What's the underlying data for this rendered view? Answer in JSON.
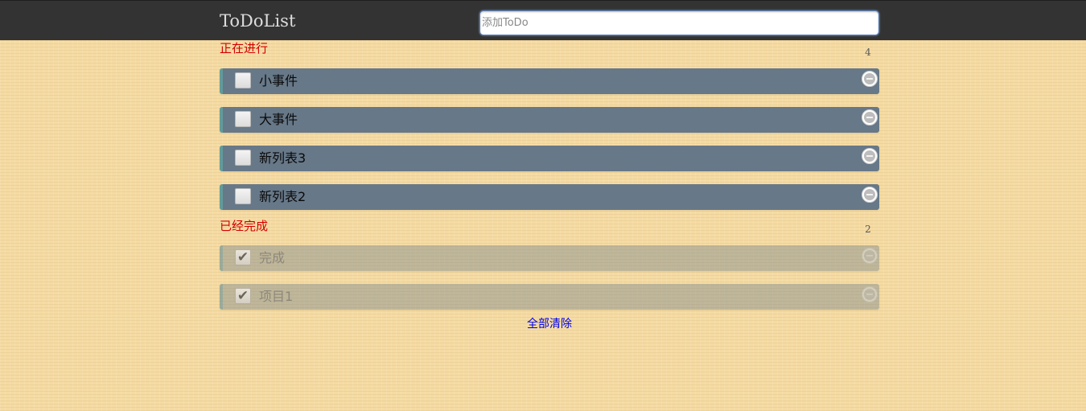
{
  "header": {
    "title": "ToDoList",
    "input_placeholder": "添加ToDo",
    "input_value": ""
  },
  "doing": {
    "title": "正在进行",
    "count": "4",
    "items": [
      {
        "text": "小事件",
        "checked": false
      },
      {
        "text": "大事件",
        "checked": false
      },
      {
        "text": "新列表3",
        "checked": false
      },
      {
        "text": "新列表2",
        "checked": false
      }
    ]
  },
  "done": {
    "title": "已经完成",
    "count": "2",
    "items": [
      {
        "text": "完成",
        "checked": true,
        "check_glyph": "✔"
      },
      {
        "text": "项目1",
        "checked": true,
        "check_glyph": "✔"
      }
    ]
  },
  "footer": {
    "clear_all_label": "全部清除"
  },
  "icons": {
    "checkbox": "checkbox-icon",
    "delete": "minus-circle-icon"
  },
  "colors": {
    "header_bg": "#333333",
    "page_bg": "#f5dba3",
    "item_bg": "#677888",
    "item_accent": "#629a9a",
    "section_title": "#d40000",
    "link": "#0000ee"
  }
}
